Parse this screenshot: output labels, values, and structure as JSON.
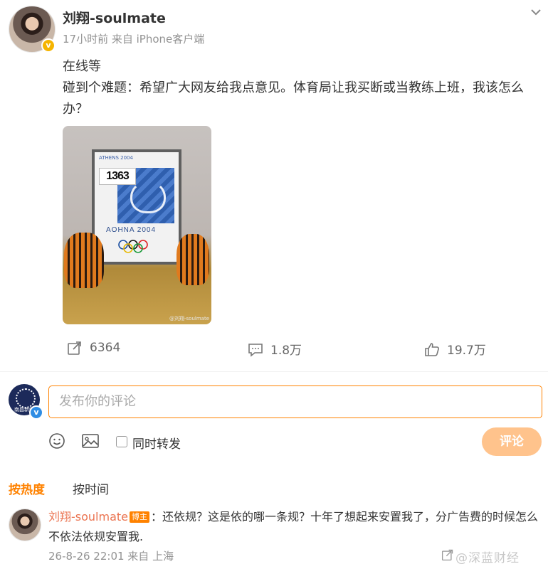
{
  "post": {
    "author": "刘翔-soulmate",
    "meta": "17小时前 来自 iPhone客户端",
    "text_line1": "在线等",
    "text_line2": "碰到个难题：希望广大网友给我点意见。体育局让我买断或当教练上班，我该怎么办？",
    "photo": {
      "frame_header": "ATHENS 2004",
      "bib": "1363",
      "poster_caption": "AOHNA 2004",
      "photo_watermark": "@刘翔-soulmate"
    }
  },
  "actions": {
    "forward_count": "6364",
    "comment_count": "1.8万",
    "like_count": "19.7万"
  },
  "composer": {
    "placeholder": "发布你的评论",
    "forward_label": "同时转发",
    "submit_label": "评论",
    "my_avatar_label": "南昌新闻"
  },
  "sort_tabs": {
    "hot": "按热度",
    "time": "按时间"
  },
  "comment": {
    "user": "刘翔-soulmate",
    "badge": "博主",
    "text": "：还依规？这是依的哪一条规？十年了想起来安置我了，分广告费的时候怎么不依法依规安置我.",
    "meta": "26-8-26 22:01 来自 上海"
  },
  "watermark": "@深蓝财经",
  "colors": {
    "accent": "#ff8200",
    "username_comment": "#eb7350",
    "verified_badge": "#f5b400",
    "muted": "#939393"
  }
}
